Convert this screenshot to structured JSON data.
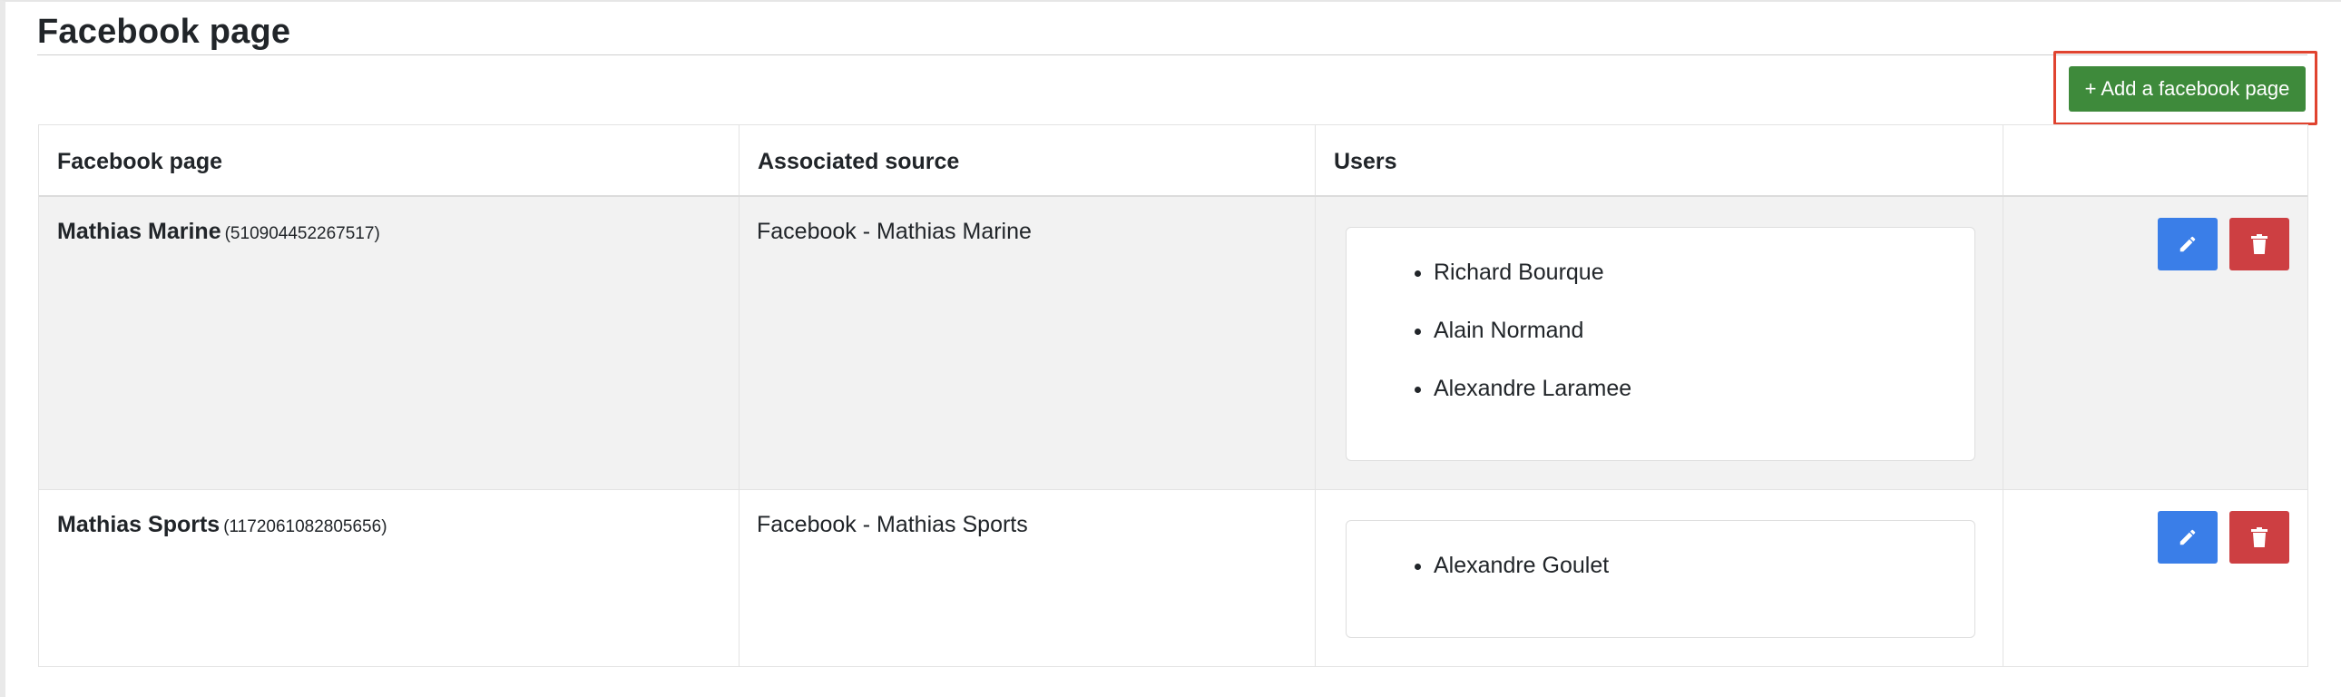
{
  "page": {
    "title": "Facebook page"
  },
  "toolbar": {
    "add_label": "+ Add a facebook page"
  },
  "table": {
    "headers": [
      "Facebook page",
      "Associated source",
      "Users",
      ""
    ],
    "rows": [
      {
        "name": "Mathias Marine",
        "page_id": "(510904452267517)",
        "source": "Facebook - Mathias Marine",
        "users": [
          "Richard Bourque",
          "Alain Normand",
          "Alexandre Laramee"
        ]
      },
      {
        "name": "Mathias Sports",
        "page_id": "(1172061082805656)",
        "source": "Facebook - Mathias Sports",
        "users": [
          "Alexandre Goulet"
        ]
      }
    ]
  },
  "icons": {
    "edit": "pencil-icon",
    "delete": "trash-icon"
  },
  "colors": {
    "add": "#3e8a3b",
    "edit": "#3a7ee8",
    "delete": "#cd3f42",
    "highlight": "#e0432f"
  }
}
